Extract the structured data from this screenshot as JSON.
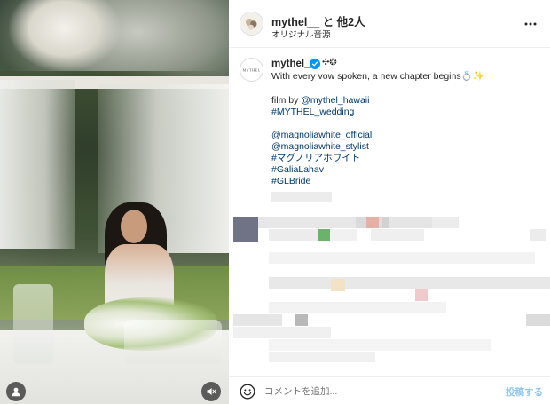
{
  "header": {
    "title": "mythel__ と 他2人",
    "subtitle": "オリジナル音源",
    "avatar_icon": "profile-avatar-icon",
    "more_icon": "more-options-icon"
  },
  "caption": {
    "username": "mythel__",
    "marks": "✣❂",
    "line1": "With every vow spoken, a new chapter begins💍✨",
    "film_by_prefix": "film by ",
    "film_by_handle": "@mythel_hawaii",
    "hashtag_wedding": "#MYTHEL_wedding",
    "mention_official": "@magnoliawhite_official",
    "mention_stylist": "@magnoliawhite_stylist",
    "hashtag_jp": "#マグノリアホワイト",
    "hashtag_galia": "#GaliaLahav",
    "hashtag_glbride": "#GLBride",
    "avatar_label": "MYTHEL"
  },
  "footer": {
    "emoji_icon": "emoji-smiley-icon",
    "placeholder": "コメントを追加...",
    "post_label": "投稿する"
  },
  "media": {
    "user_icon": "person-tag-icon",
    "mute_icon": "muted-speaker-icon"
  },
  "colors": {
    "link": "#00376b",
    "verified": "#0095f6",
    "post_disabled": "#8ec5ef"
  }
}
